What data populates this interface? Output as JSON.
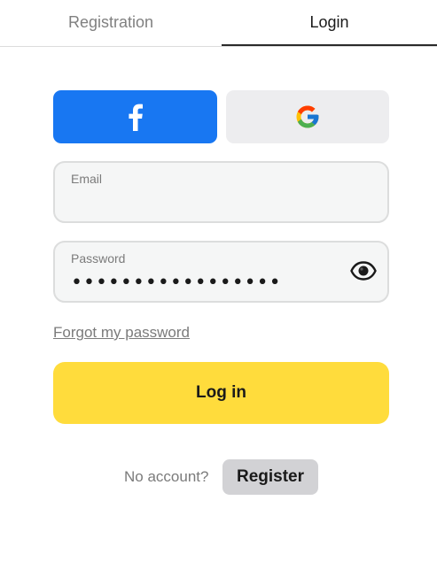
{
  "tabs": {
    "registration": "Registration",
    "login": "Login",
    "active": "login"
  },
  "social": {
    "facebook_icon": "facebook-icon",
    "google_icon": "google-icon",
    "facebook_color": "#1877f2"
  },
  "form": {
    "email": {
      "label": "Email",
      "value": ""
    },
    "password": {
      "label": "Password",
      "value": "•••••••••••••••••",
      "toggle_icon": "eye-icon"
    },
    "forgot_link": "Forgot my password",
    "submit_label": "Log in",
    "submit_color": "#ffdc3c"
  },
  "footer": {
    "no_account_text": "No account?",
    "register_label": "Register"
  }
}
